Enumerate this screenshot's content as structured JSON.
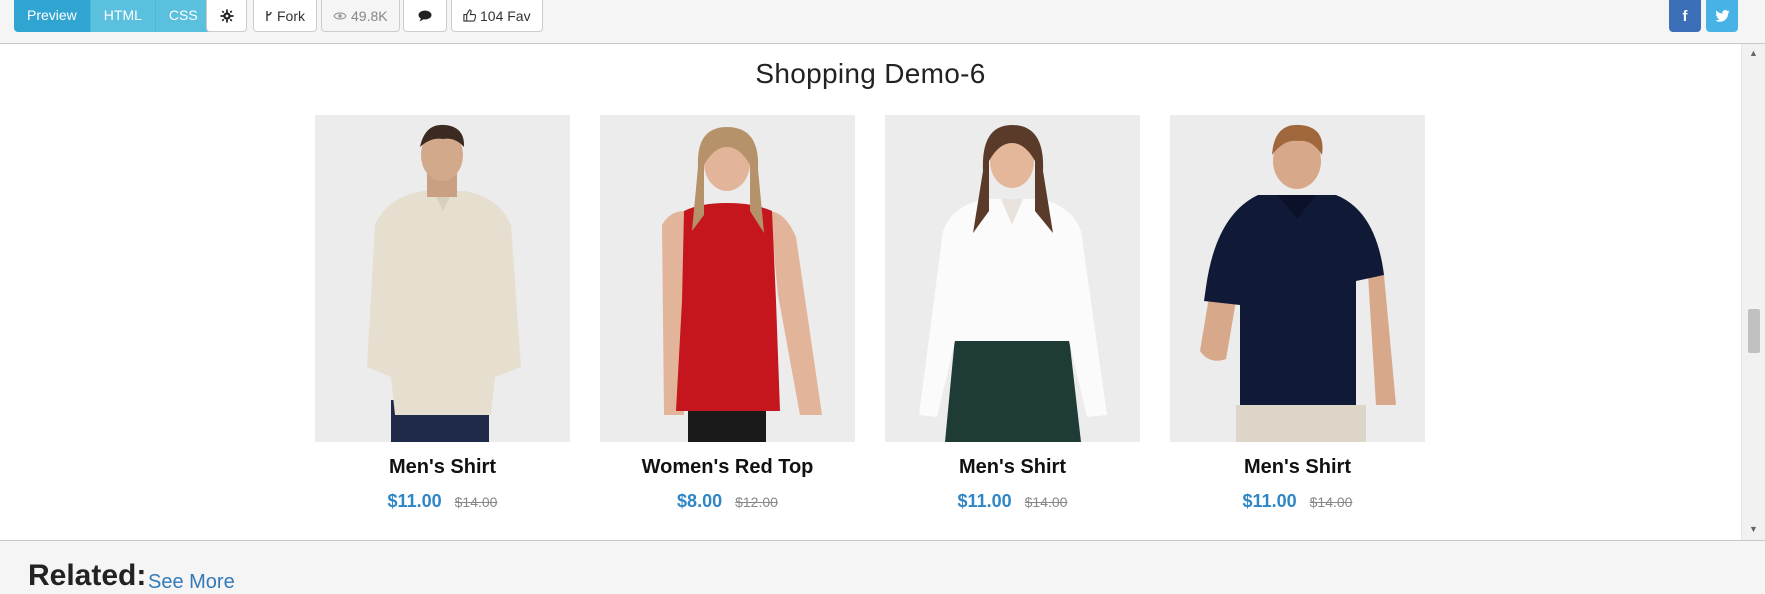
{
  "toolbar": {
    "tabs": [
      "Preview",
      "HTML",
      "CSS"
    ],
    "fork_label": "Fork",
    "views_label": "49.8K",
    "fav_label": "104 Fav",
    "facebook_label": "f"
  },
  "demo": {
    "title": "Shopping Demo-6",
    "products": [
      {
        "name": "Men's Shirt",
        "price": "$11.00",
        "old_price": "$14.00"
      },
      {
        "name": "Women's Red Top",
        "price": "$8.00",
        "old_price": "$12.00"
      },
      {
        "name": "Men's Shirt",
        "price": "$11.00",
        "old_price": "$14.00"
      },
      {
        "name": "Men's Shirt",
        "price": "$11.00",
        "old_price": "$14.00"
      }
    ]
  },
  "related": {
    "heading": "Related:",
    "see_more": "See More"
  },
  "colors": {
    "accent": "#5bc0de",
    "price": "#2f86c6",
    "link": "#337ab7"
  }
}
